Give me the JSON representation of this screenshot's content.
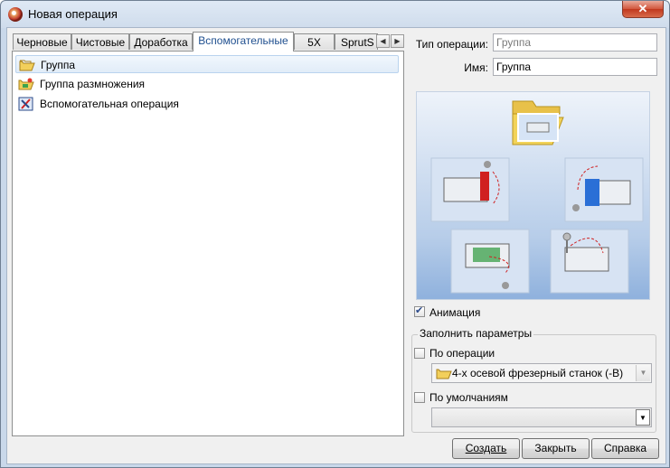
{
  "window": {
    "title": "Новая операция",
    "close_label": "✕"
  },
  "tabs": [
    {
      "label": "Черновые"
    },
    {
      "label": "Чистовые"
    },
    {
      "label": "Доработка"
    },
    {
      "label": "Вспомогательные",
      "active": true
    },
    {
      "label": "5X"
    },
    {
      "label": "SprutS"
    }
  ],
  "tab_scroll": {
    "left": "◀",
    "right": "▶"
  },
  "list": {
    "items": [
      {
        "label": "Группа",
        "icon": "folder-icon",
        "selected": true
      },
      {
        "label": "Группа размножения",
        "icon": "folder-multiply-icon"
      },
      {
        "label": "Вспомогательная операция",
        "icon": "auxiliary-operation-icon"
      }
    ]
  },
  "fields": {
    "operation_type_label": "Тип операции:",
    "operation_type_value": "Группа",
    "name_label": "Имя:",
    "name_value": "Группа"
  },
  "animation": {
    "label": "Анимация",
    "checked": true
  },
  "fill_params": {
    "title": "Заполнить параметры",
    "by_operation_label": "По операции",
    "by_operation_checked": false,
    "machine_value": "4-х осевой фрезерный станок (-B)",
    "by_default_label": "По умолчаниям",
    "by_default_checked": false,
    "default_value": ""
  },
  "buttons": {
    "create": "Создать",
    "close": "Закрыть",
    "help": "Справка"
  },
  "colors": {
    "accent": "#1f4f8f",
    "folder": "#e8c14a",
    "preview_bg": "#9fbde3",
    "red_highlight": "#d02020",
    "blue_highlight": "#2a6fd6",
    "green_highlight": "#2e9a3c"
  }
}
